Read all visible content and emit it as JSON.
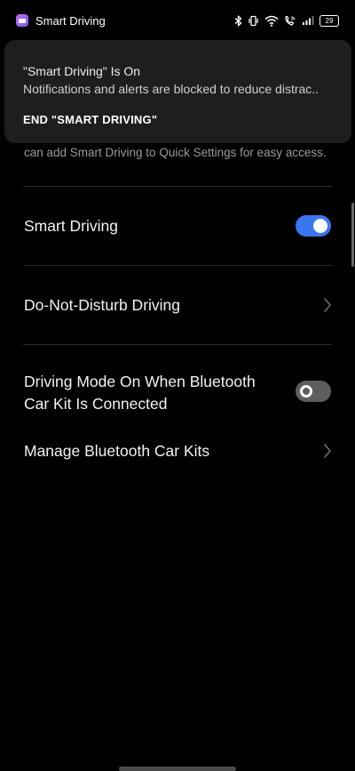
{
  "status_bar": {
    "app_name": "Smart Driving",
    "battery_level": "29",
    "icons": [
      "bluetooth-icon",
      "vibrate-icon",
      "wifi-icon",
      "wifi-calling-icon",
      "signal-icon",
      "battery-icon"
    ]
  },
  "notification": {
    "title": "\"Smart Driving\" Is On",
    "body": "Notifications and alerts are blocked to reduce distrac..",
    "action_label": "END \"SMART DRIVING\""
  },
  "page": {
    "hint_text": "can add Smart Driving to Quick Settings for easy access.",
    "items": [
      {
        "label": "Smart Driving",
        "control": "toggle",
        "enabled": true
      },
      {
        "label": "Do-Not-Disturb Driving",
        "control": "chevron"
      },
      {
        "label_line1": "Driving Mode On When Bluetooth",
        "label_line2": "Car Kit Is Connected",
        "control": "toggle",
        "enabled": false
      },
      {
        "label": "Manage Bluetooth Car Kits",
        "control": "chevron"
      }
    ]
  },
  "colors": {
    "background": "#000000",
    "accent": "#3a76f0",
    "notification_bg": "#1e1e1e",
    "toggle_off": "#5e5e5e"
  }
}
